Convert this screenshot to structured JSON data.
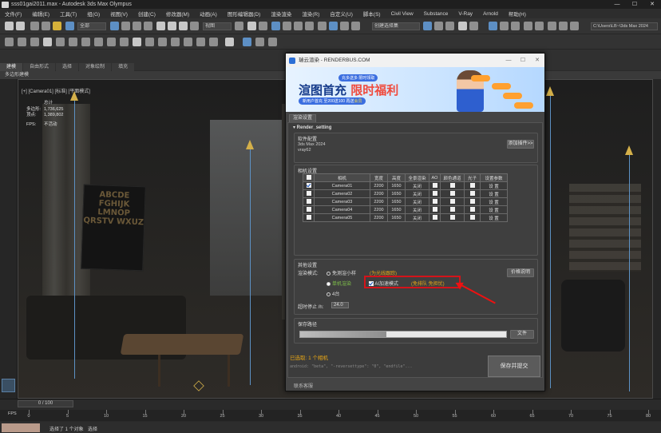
{
  "window": {
    "title": "sss01gai2011.max - Autodesk 3ds Max Olympus",
    "controls": [
      "—",
      "☐",
      "✕"
    ]
  },
  "menu": {
    "items": [
      "文件(F)",
      "编辑(E)",
      "工具(T)",
      "组(G)",
      "视图(V)",
      "创建(C)",
      "修改器(M)",
      "动画(A)",
      "图形编辑器(D)",
      "渲染渲染",
      "渲染(R)",
      "自定义(U)",
      "脚本(S)",
      "Civil View",
      "Substance",
      "V-Ray",
      "Arnold",
      "帮助(H)"
    ]
  },
  "toolbar": {
    "selection_filter": "全部",
    "view_dropdown": "视图",
    "named_selection": "创建选择集",
    "project_path": "C:\\Users\\LB~\\3ds Max 2024"
  },
  "ribbon": {
    "tabs": [
      "建模",
      "自由形式",
      "选择",
      "对象绘制",
      "填充"
    ],
    "subtab": "多边形建模"
  },
  "viewport": {
    "label": "[+] [Camera01] [标准] [平面模式]",
    "stats": [
      {
        "label": "",
        "value": "总计"
      },
      {
        "label": "多边形:",
        "value": "1,736,625"
      },
      {
        "label": "顶点:",
        "value": "1,389,802"
      },
      {
        "label": "FPS:",
        "value": "不活动"
      }
    ],
    "poster_text": "ABCDE FGHIJK LMNOP QRSTV WXUZ"
  },
  "timeline": {
    "frame_display": "0 / 100",
    "fps_label": "FPS",
    "ticks": [
      "0",
      "5",
      "10",
      "15",
      "20",
      "25",
      "30",
      "35",
      "40",
      "45",
      "50",
      "55",
      "60",
      "65",
      "70",
      "75",
      "80"
    ]
  },
  "status": {
    "text1": "选择了 1 个对象",
    "text2": "选择"
  },
  "dialog": {
    "title": "瑞云渲染 - RENDERBUS.COM",
    "controls": [
      "—",
      "☐",
      "✕"
    ],
    "banner": {
      "badge": "充多送多 限时领取",
      "headline_plain": "渲图首充",
      "headline_highlight": "限时福利",
      "subtitle_plain": "新用户首充 至200送100 再送",
      "subtitle_highlight": "会员",
      "coin_labels": [
        "",
        "",
        "",
        ""
      ]
    },
    "tab": "渲染设置",
    "header": "▾ Render_setting",
    "software": {
      "title": "软件配置",
      "lines": [
        "3ds Max 2024",
        "vray62"
      ],
      "add_plugin_button": "添加插件>>"
    },
    "camera": {
      "title": "相机设置",
      "headers": [
        "",
        "相机",
        "宽度",
        "高度",
        "全景渲染",
        "AO",
        "颜色通道",
        "光子",
        "设置参数"
      ],
      "rows": [
        {
          "checked": true,
          "name": "Camera01",
          "width": "2200",
          "height": "1650",
          "pano": "关闭",
          "settings": "设 置"
        },
        {
          "checked": false,
          "name": "Camera02",
          "width": "2200",
          "height": "1650",
          "pano": "关闭",
          "settings": "设 置"
        },
        {
          "checked": false,
          "name": "Camera03",
          "width": "2200",
          "height": "1650",
          "pano": "关闭",
          "settings": "设 置"
        },
        {
          "checked": false,
          "name": "Camera04",
          "width": "2200",
          "height": "1650",
          "pano": "关闭",
          "settings": "设 置"
        },
        {
          "checked": false,
          "name": "Camera05",
          "width": "2200",
          "height": "1650",
          "pano": "关闭",
          "settings": "设 置"
        }
      ]
    },
    "other": {
      "title": "其他设置",
      "render_mode_label": "渲染模式:",
      "mode_free": "免测渲小样",
      "mode_free_note": "(为光线跟踪)",
      "price_button": "价格说明",
      "mode_standard": "单机渲染",
      "ai_label": "AI加速模式",
      "ai_note": "(免排队 免担忧)",
      "mode_4": "4台",
      "timeout_label": "超时停止 /h:",
      "timeout_value": "24.0"
    },
    "save": {
      "title": "保存路径",
      "progress_fraction": 0.42,
      "file_button": "文件"
    },
    "selected_count": "已选取: 1 个相机",
    "code_line": "android: \"beta\", \"-reversettype\": \"0\", \"endfile\"...",
    "submit_button": "保存并提交",
    "footer_link": "联系客服"
  }
}
